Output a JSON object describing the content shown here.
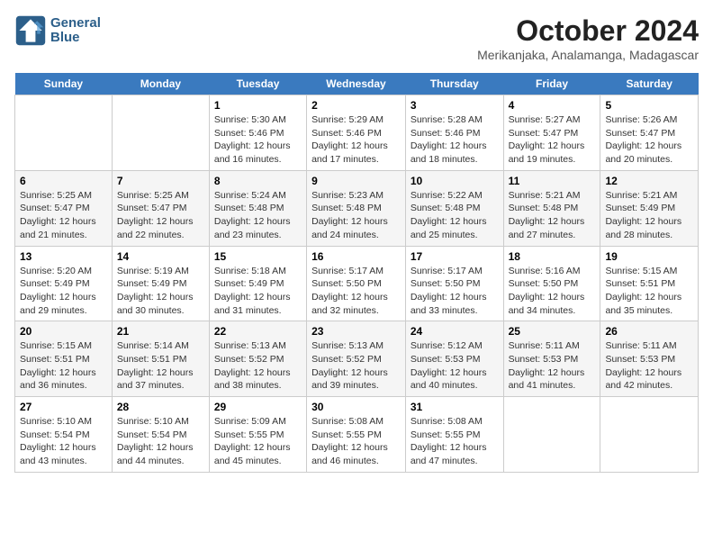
{
  "logo": {
    "line1": "General",
    "line2": "Blue"
  },
  "title": "October 2024",
  "subtitle": "Merikanjaka, Analamanga, Madagascar",
  "weekdays": [
    "Sunday",
    "Monday",
    "Tuesday",
    "Wednesday",
    "Thursday",
    "Friday",
    "Saturday"
  ],
  "weeks": [
    [
      {
        "date": "",
        "info": ""
      },
      {
        "date": "",
        "info": ""
      },
      {
        "date": "1",
        "sunrise": "5:30 AM",
        "sunset": "5:46 PM",
        "daylight": "12 hours and 16 minutes."
      },
      {
        "date": "2",
        "sunrise": "5:29 AM",
        "sunset": "5:46 PM",
        "daylight": "12 hours and 17 minutes."
      },
      {
        "date": "3",
        "sunrise": "5:28 AM",
        "sunset": "5:46 PM",
        "daylight": "12 hours and 18 minutes."
      },
      {
        "date": "4",
        "sunrise": "5:27 AM",
        "sunset": "5:47 PM",
        "daylight": "12 hours and 19 minutes."
      },
      {
        "date": "5",
        "sunrise": "5:26 AM",
        "sunset": "5:47 PM",
        "daylight": "12 hours and 20 minutes."
      }
    ],
    [
      {
        "date": "6",
        "sunrise": "5:25 AM",
        "sunset": "5:47 PM",
        "daylight": "12 hours and 21 minutes."
      },
      {
        "date": "7",
        "sunrise": "5:25 AM",
        "sunset": "5:47 PM",
        "daylight": "12 hours and 22 minutes."
      },
      {
        "date": "8",
        "sunrise": "5:24 AM",
        "sunset": "5:48 PM",
        "daylight": "12 hours and 23 minutes."
      },
      {
        "date": "9",
        "sunrise": "5:23 AM",
        "sunset": "5:48 PM",
        "daylight": "12 hours and 24 minutes."
      },
      {
        "date": "10",
        "sunrise": "5:22 AM",
        "sunset": "5:48 PM",
        "daylight": "12 hours and 25 minutes."
      },
      {
        "date": "11",
        "sunrise": "5:21 AM",
        "sunset": "5:48 PM",
        "daylight": "12 hours and 27 minutes."
      },
      {
        "date": "12",
        "sunrise": "5:21 AM",
        "sunset": "5:49 PM",
        "daylight": "12 hours and 28 minutes."
      }
    ],
    [
      {
        "date": "13",
        "sunrise": "5:20 AM",
        "sunset": "5:49 PM",
        "daylight": "12 hours and 29 minutes."
      },
      {
        "date": "14",
        "sunrise": "5:19 AM",
        "sunset": "5:49 PM",
        "daylight": "12 hours and 30 minutes."
      },
      {
        "date": "15",
        "sunrise": "5:18 AM",
        "sunset": "5:49 PM",
        "daylight": "12 hours and 31 minutes."
      },
      {
        "date": "16",
        "sunrise": "5:17 AM",
        "sunset": "5:50 PM",
        "daylight": "12 hours and 32 minutes."
      },
      {
        "date": "17",
        "sunrise": "5:17 AM",
        "sunset": "5:50 PM",
        "daylight": "12 hours and 33 minutes."
      },
      {
        "date": "18",
        "sunrise": "5:16 AM",
        "sunset": "5:50 PM",
        "daylight": "12 hours and 34 minutes."
      },
      {
        "date": "19",
        "sunrise": "5:15 AM",
        "sunset": "5:51 PM",
        "daylight": "12 hours and 35 minutes."
      }
    ],
    [
      {
        "date": "20",
        "sunrise": "5:15 AM",
        "sunset": "5:51 PM",
        "daylight": "12 hours and 36 minutes."
      },
      {
        "date": "21",
        "sunrise": "5:14 AM",
        "sunset": "5:51 PM",
        "daylight": "12 hours and 37 minutes."
      },
      {
        "date": "22",
        "sunrise": "5:13 AM",
        "sunset": "5:52 PM",
        "daylight": "12 hours and 38 minutes."
      },
      {
        "date": "23",
        "sunrise": "5:13 AM",
        "sunset": "5:52 PM",
        "daylight": "12 hours and 39 minutes."
      },
      {
        "date": "24",
        "sunrise": "5:12 AM",
        "sunset": "5:53 PM",
        "daylight": "12 hours and 40 minutes."
      },
      {
        "date": "25",
        "sunrise": "5:11 AM",
        "sunset": "5:53 PM",
        "daylight": "12 hours and 41 minutes."
      },
      {
        "date": "26",
        "sunrise": "5:11 AM",
        "sunset": "5:53 PM",
        "daylight": "12 hours and 42 minutes."
      }
    ],
    [
      {
        "date": "27",
        "sunrise": "5:10 AM",
        "sunset": "5:54 PM",
        "daylight": "12 hours and 43 minutes."
      },
      {
        "date": "28",
        "sunrise": "5:10 AM",
        "sunset": "5:54 PM",
        "daylight": "12 hours and 44 minutes."
      },
      {
        "date": "29",
        "sunrise": "5:09 AM",
        "sunset": "5:55 PM",
        "daylight": "12 hours and 45 minutes."
      },
      {
        "date": "30",
        "sunrise": "5:08 AM",
        "sunset": "5:55 PM",
        "daylight": "12 hours and 46 minutes."
      },
      {
        "date": "31",
        "sunrise": "5:08 AM",
        "sunset": "5:55 PM",
        "daylight": "12 hours and 47 minutes."
      },
      {
        "date": "",
        "info": ""
      },
      {
        "date": "",
        "info": ""
      }
    ]
  ]
}
